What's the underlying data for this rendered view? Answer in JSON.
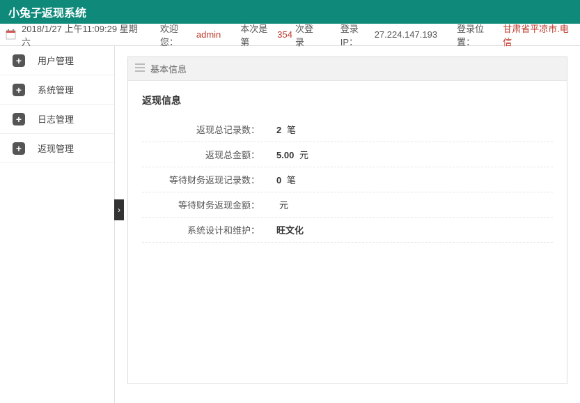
{
  "header": {
    "title": "小兔子返现系统"
  },
  "infoBar": {
    "datetime": "2018/1/27 上午11:09:29 星期六",
    "welcomeLabel": "欢迎您：",
    "username": "admin",
    "loginCountPrefix": "本次是第",
    "loginCount": "354",
    "loginCountSuffix": "次登录",
    "ipLabel": "登录IP：",
    "ip": "27.224.147.193",
    "locationLabel": "登录位置：",
    "location": "甘肃省平凉市.电信"
  },
  "sidebar": {
    "items": [
      {
        "label": "用户管理"
      },
      {
        "label": "系统管理"
      },
      {
        "label": "日志管理"
      },
      {
        "label": "返现管理"
      }
    ]
  },
  "panel": {
    "headerTitle": "基本信息",
    "sectionTitle": "返现信息",
    "rows": [
      {
        "label": "返现总记录数：",
        "value": "2",
        "unit": "笔"
      },
      {
        "label": "返现总金额：",
        "value": "5.00",
        "unit": "元"
      },
      {
        "label": "等待财务返现记录数：",
        "value": "0",
        "unit": "笔"
      },
      {
        "label": "等待财务返现金额：",
        "value": "",
        "unit": "元"
      },
      {
        "label": "系统设计和维护：",
        "value": "旺文化",
        "unit": ""
      }
    ]
  },
  "collapseGlyph": "›"
}
